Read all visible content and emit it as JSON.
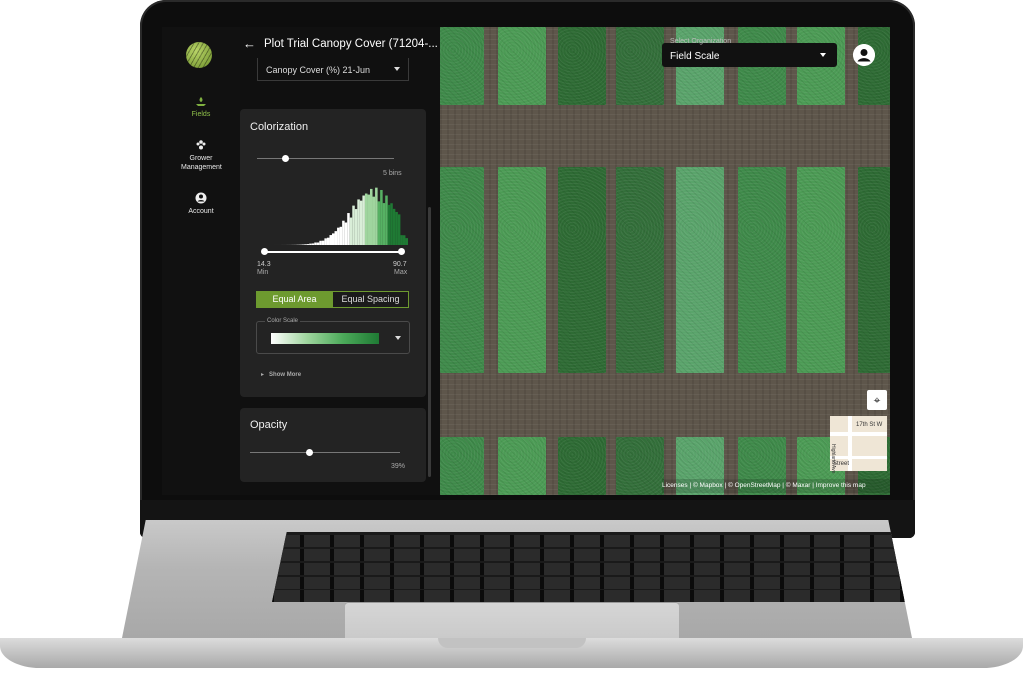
{
  "nav": {
    "items": [
      {
        "label": "Fields",
        "icon": "fields-icon"
      },
      {
        "label": "Grower Management",
        "icon": "people-icon"
      },
      {
        "label": "Account",
        "icon": "account-icon"
      }
    ]
  },
  "panel": {
    "title": "Plot Trial Canopy Cover (71204-...",
    "layer_select": "Canopy Cover (%) 21-Jun",
    "colorization": {
      "title": "Colorization",
      "bins_label": "5 bins",
      "min_value": "14.3",
      "min_label": "Min",
      "max_value": "90.7",
      "max_label": "Max",
      "mode_equal_area": "Equal Area",
      "mode_equal_spacing": "Equal Spacing",
      "color_scale_label": "Color Scale",
      "show_more": "Show More"
    },
    "opacity": {
      "title": "Opacity",
      "value_label": "39%",
      "value": 0.39
    }
  },
  "map": {
    "org_label": "Select Organization",
    "org_value": "Field Scale",
    "minimap_labels": [
      "17th St W",
      "Highland Ave",
      "Street"
    ],
    "attribution": "Licenses | © Mapbox | © OpenStreetMap | © Maxar | Improve this map"
  },
  "colors": {
    "accent": "#6d9a2f",
    "panel_bg": "#232323",
    "plot_greens": [
      "#3f8a4a",
      "#2e6b34",
      "#5aa46b",
      "#4c9b55",
      "#336f3a"
    ]
  }
}
